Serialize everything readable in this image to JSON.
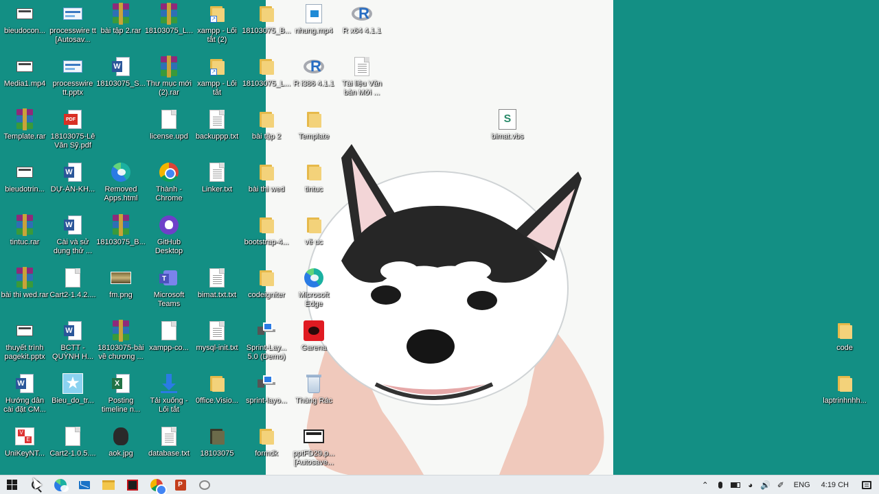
{
  "desktop": {
    "background_color": "#138f84",
    "icons": [
      {
        "label": "bieudocon...",
        "icon": "screen-icon"
      },
      {
        "label": "processwire tt [Autosav...",
        "icon": "process-icon"
      },
      {
        "label": "bài tập 2.rar",
        "icon": "rar-icon"
      },
      {
        "label": "18103075_L...",
        "icon": "rar-icon"
      },
      {
        "label": "xampp - Lối tắt (2)",
        "icon": "folder-shortcut-icon"
      },
      {
        "label": "18103075_B...",
        "icon": "folder-icon"
      },
      {
        "label": "nhung.mp4",
        "icon": "video-icon"
      },
      {
        "label": "R x64 4.1.1",
        "icon": "r-icon"
      },
      {
        "label": "Media1.mp4",
        "icon": "screen-icon"
      },
      {
        "label": "processwire tt.pptx",
        "icon": "process-icon"
      },
      {
        "label": "18103075_S...",
        "icon": "word-icon"
      },
      {
        "label": "Thư mục mới (2).rar",
        "icon": "rar-icon"
      },
      {
        "label": "xampp - Lối tắt",
        "icon": "folder-shortcut-icon"
      },
      {
        "label": "18103075_L...",
        "icon": "folder-icon"
      },
      {
        "label": "R i386 4.1.1",
        "icon": "r-icon"
      },
      {
        "label": "Tài liệu Văn bản Mới ...",
        "icon": "text-file-icon"
      },
      {
        "label": "Template.rar",
        "icon": "rar-icon"
      },
      {
        "label": "18103075-Lê Văn Sỹ.pdf",
        "icon": "pdf-icon"
      },
      {
        "label": "license.upd",
        "icon": "blank-file-icon"
      },
      {
        "label": "backuppp.txt",
        "icon": "text-file-icon"
      },
      {
        "label": "bài tập 2",
        "icon": "folder-icon"
      },
      {
        "label": "Template",
        "icon": "folder-icon"
      },
      {
        "label": "bimat.vbs",
        "icon": "vbs-icon"
      },
      {
        "label": "bieudotrin...",
        "icon": "screen-icon"
      },
      {
        "label": "DỰ-ÁN-KH...",
        "icon": "word-icon"
      },
      {
        "label": "Removed Apps.html",
        "icon": "edge-icon"
      },
      {
        "label": "Thành - Chrome",
        "icon": "chrome-icon"
      },
      {
        "label": "Linker.txt",
        "icon": "text-file-icon"
      },
      {
        "label": "bài thi wed",
        "icon": "folder-icon"
      },
      {
        "label": "tintuc",
        "icon": "folder-icon"
      },
      {
        "label": "tintuc.rar",
        "icon": "rar-icon"
      },
      {
        "label": "Cài và sử dụng thử ...",
        "icon": "word-icon"
      },
      {
        "label": "18103075_B...",
        "icon": "rar-icon"
      },
      {
        "label": "GitHub Desktop",
        "icon": "github-icon"
      },
      {
        "label": "bootstrap-4...",
        "icon": "folder-icon"
      },
      {
        "label": "vẽ uc",
        "icon": "folder-icon"
      },
      {
        "label": "bài thi wed.rar",
        "icon": "rar-icon"
      },
      {
        "label": "Cart2-1.4.2....",
        "icon": "blank-file-icon"
      },
      {
        "label": "fm.png",
        "icon": "image-icon"
      },
      {
        "label": "Microsoft Teams",
        "icon": "teams-icon"
      },
      {
        "label": "bimat.txt.txt",
        "icon": "text-file-icon"
      },
      {
        "label": "codeigniter",
        "icon": "folder-icon"
      },
      {
        "label": "Microsoft Edge",
        "icon": "edge-icon"
      },
      {
        "label": "thuyết trình pagekit.pptx",
        "icon": "screen-icon"
      },
      {
        "label": "BCTT - QUỲNH H...",
        "icon": "word-icon"
      },
      {
        "label": "18103075-bài về chương ...",
        "icon": "rar-icon"
      },
      {
        "label": "xampp-co...",
        "icon": "blank-file-icon"
      },
      {
        "label": "mysql-init.txt",
        "icon": "text-file-icon"
      },
      {
        "label": "Sprint-Lay... 5.0 (Demo)",
        "icon": "sprint-icon"
      },
      {
        "label": "Garena",
        "icon": "garena-icon"
      },
      {
        "label": "code",
        "icon": "folder-icon"
      },
      {
        "label": "Hướng dẫn cài đặt CM...",
        "icon": "word-icon"
      },
      {
        "label": "Bieu_do_tr...",
        "icon": "star-icon"
      },
      {
        "label": "Posting timeline n...",
        "icon": "excel-icon"
      },
      {
        "label": "Tải xuống - Lối tắt",
        "icon": "download-icon"
      },
      {
        "label": "0ffice.Visio...",
        "icon": "folder-icon"
      },
      {
        "label": "sprint-layo...",
        "icon": "sprint-icon"
      },
      {
        "label": "Thùng Rác",
        "icon": "trash-icon"
      },
      {
        "label": "laptrinhnhh...",
        "icon": "folder-icon"
      },
      {
        "label": "UniKeyNT...",
        "icon": "unikey-icon"
      },
      {
        "label": "Cart2-1.0.5....",
        "icon": "blank-file-icon"
      },
      {
        "label": "aok.jpg",
        "icon": "blob-icon"
      },
      {
        "label": "database.txt",
        "icon": "text-file-icon"
      },
      {
        "label": "18103075",
        "icon": "folder-dark-icon"
      },
      {
        "label": "formdk",
        "icon": "folder-icon"
      },
      {
        "label": "pptFD29.p... [Autosave...",
        "icon": "monitor-icon"
      }
    ]
  },
  "taskbar": {
    "apps": [
      {
        "name": "start-button",
        "icon": "windows-icon"
      },
      {
        "name": "search-button",
        "icon": "search-icon"
      },
      {
        "name": "taskbar-edge",
        "icon": "edge-icon"
      },
      {
        "name": "taskbar-mail",
        "icon": "mail-icon"
      },
      {
        "name": "taskbar-explorer",
        "icon": "folder-icon"
      },
      {
        "name": "taskbar-acrobat",
        "icon": "acrobat-icon"
      },
      {
        "name": "taskbar-chrome",
        "icon": "chrome-icon"
      },
      {
        "name": "taskbar-powerpoint",
        "icon": "powerpoint-icon"
      },
      {
        "name": "taskbar-snip",
        "icon": "snip-icon"
      }
    ],
    "tray": {
      "language": "ENG",
      "clock": "4:19 CH"
    }
  }
}
